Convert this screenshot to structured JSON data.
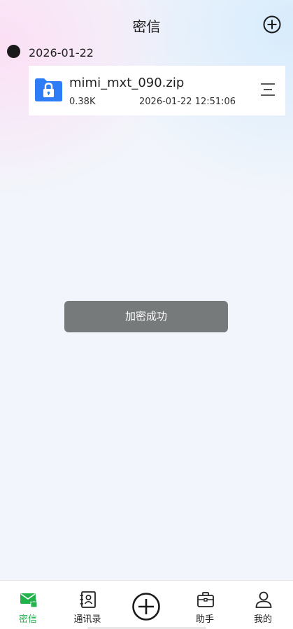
{
  "header": {
    "title": "密信"
  },
  "list": {
    "date": "2026-01-22",
    "files": [
      {
        "name": "mimi_mxt_090.zip",
        "size": "0.38K",
        "time": "2026-01-22 12:51:06"
      }
    ]
  },
  "toast": {
    "message": "加密成功"
  },
  "tabbar": {
    "tabs": [
      {
        "label": "密信",
        "icon": "mail-lock-icon",
        "active": true
      },
      {
        "label": "通讯录",
        "icon": "contacts-icon",
        "active": false
      },
      {
        "label": "",
        "icon": "plus-circle-icon",
        "active": false
      },
      {
        "label": "助手",
        "icon": "briefcase-icon",
        "active": false
      },
      {
        "label": "我的",
        "icon": "person-icon",
        "active": false
      }
    ]
  },
  "colors": {
    "accent": "#22b24c",
    "file_icon": "#2f7df6",
    "toast_bg": "#777a7b"
  }
}
